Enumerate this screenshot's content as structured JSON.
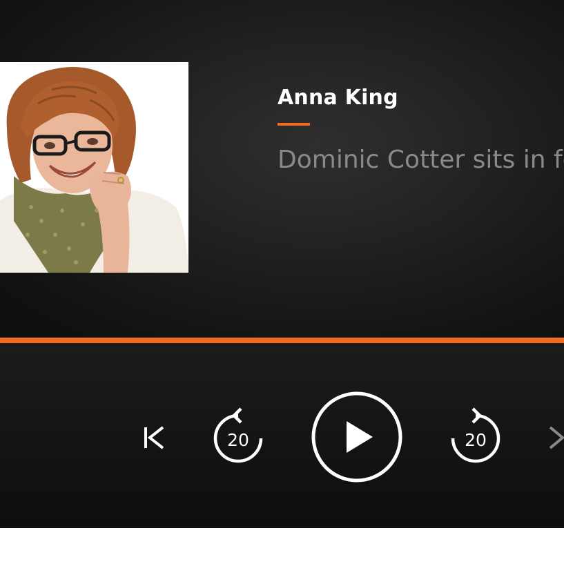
{
  "player": {
    "presenter_name": "Anna King",
    "episode_title": "Dominic Cotter sits in for Anna King",
    "artwork_alt": "Presenter photo",
    "progress_fraction": 1.0,
    "accent_color": "#f26b21",
    "controls": {
      "previous": {
        "icon": "skip-to-start-icon"
      },
      "rewind": {
        "icon": "rewind-icon",
        "label": "20"
      },
      "play": {
        "icon": "play-icon"
      },
      "forward": {
        "icon": "fast-forward-icon",
        "label": "20"
      },
      "next": {
        "icon": "chevron-right-icon"
      }
    }
  }
}
